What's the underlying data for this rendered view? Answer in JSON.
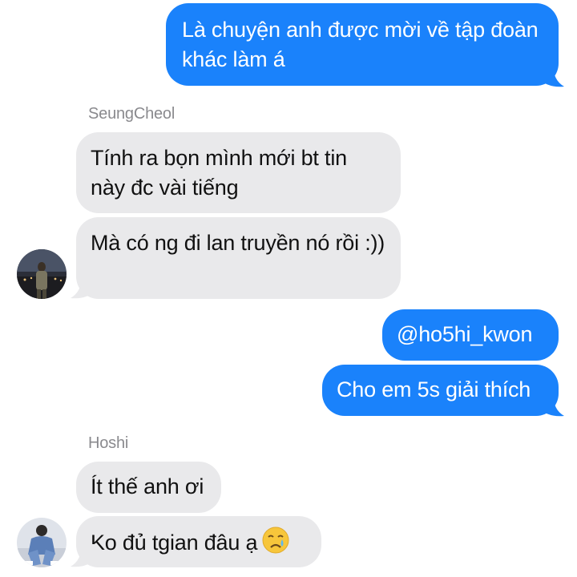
{
  "messages": [
    {
      "side": "sent",
      "text": "Là chuyện anh được mời về tập đoàn khác làm á"
    },
    {
      "side": "recv",
      "sender": "SeungCheol",
      "text": "Tính ra bọn mình mới bt tin này đc vài tiếng"
    },
    {
      "side": "recv",
      "text": "Mà có ng đi lan truyền nó rồi :))"
    },
    {
      "side": "sent",
      "text": "@ho5hi_kwon"
    },
    {
      "side": "sent",
      "text": "Cho em 5s giải thích"
    },
    {
      "side": "recv",
      "sender": "Hoshi",
      "text": "Ít thế anh ơi"
    },
    {
      "side": "recv",
      "text": "Ko đủ tgian đâu ạ",
      "emoji": "crying-face-icon"
    }
  ],
  "colors": {
    "sent_bubble": "#1a82fb",
    "recv_bubble": "#e9e9eb",
    "sender_name": "#8a8a8e"
  }
}
